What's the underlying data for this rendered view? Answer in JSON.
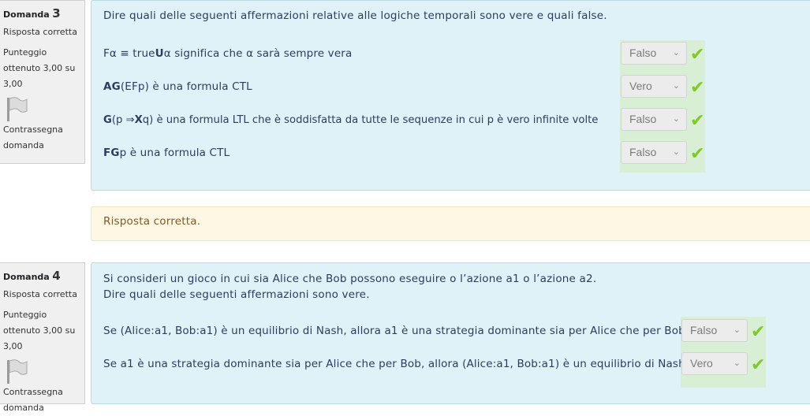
{
  "q3": {
    "domanda_label": "Domanda",
    "number": "3",
    "state": "Risposta corretta",
    "grade": "Punteggio ottenuto 3,00 su 3,00",
    "flag_label": "Contrassegna domanda",
    "question_text": "Dire quali delle seguenti affermazioni relative alle logiche temporali sono vere e quali false.",
    "statements": [
      {
        "prefix": "Fα ≡ true ",
        "bold": "U",
        "suffix": " α significa che α sarà sempre vera",
        "answer": "Falso"
      },
      {
        "prefix": "",
        "bold": "AG",
        "suffix": "(EFp) è una formula CTL",
        "answer": "Vero"
      },
      {
        "prefix": "",
        "bold": "G",
        "suffix": "(p ⇒ ",
        "bold2": "X",
        "suffix2": "q) è una formula LTL che è soddisfatta da tutte le sequenze in cui p è vero infinite volte",
        "answer": "Falso"
      },
      {
        "prefix": "",
        "bold": "FG",
        "suffix": "p è una formula CTL",
        "answer": "Falso"
      }
    ],
    "feedback": "Risposta corretta."
  },
  "q4": {
    "domanda_label": "Domanda",
    "number": "4",
    "state": "Risposta corretta",
    "grade": "Punteggio ottenuto 3,00 su 3,00",
    "flag_label": "Contrassegna domanda",
    "question_text_1": "Si consideri un gioco in cui sia Alice che Bob possono eseguire o l’azione a1 o l’azione a2.",
    "question_text_2": "Dire quali delle seguenti affermazioni sono vere.",
    "statements": [
      {
        "text": "Se (Alice:a1, Bob:a1) è un equilibrio di Nash, allora a1 è una strategia dominante sia per Alice che per Bob.",
        "answer": "Falso"
      },
      {
        "text": "Se a1 è una strategia dominante sia per Alice che per Bob, allora (Alice:a1, Bob:a1) è un equilibrio di Nash.",
        "answer": "Vero"
      }
    ]
  },
  "icons": {
    "tick": "✔",
    "chevron": "⌵",
    "correct_color": "#7ec92b"
  }
}
